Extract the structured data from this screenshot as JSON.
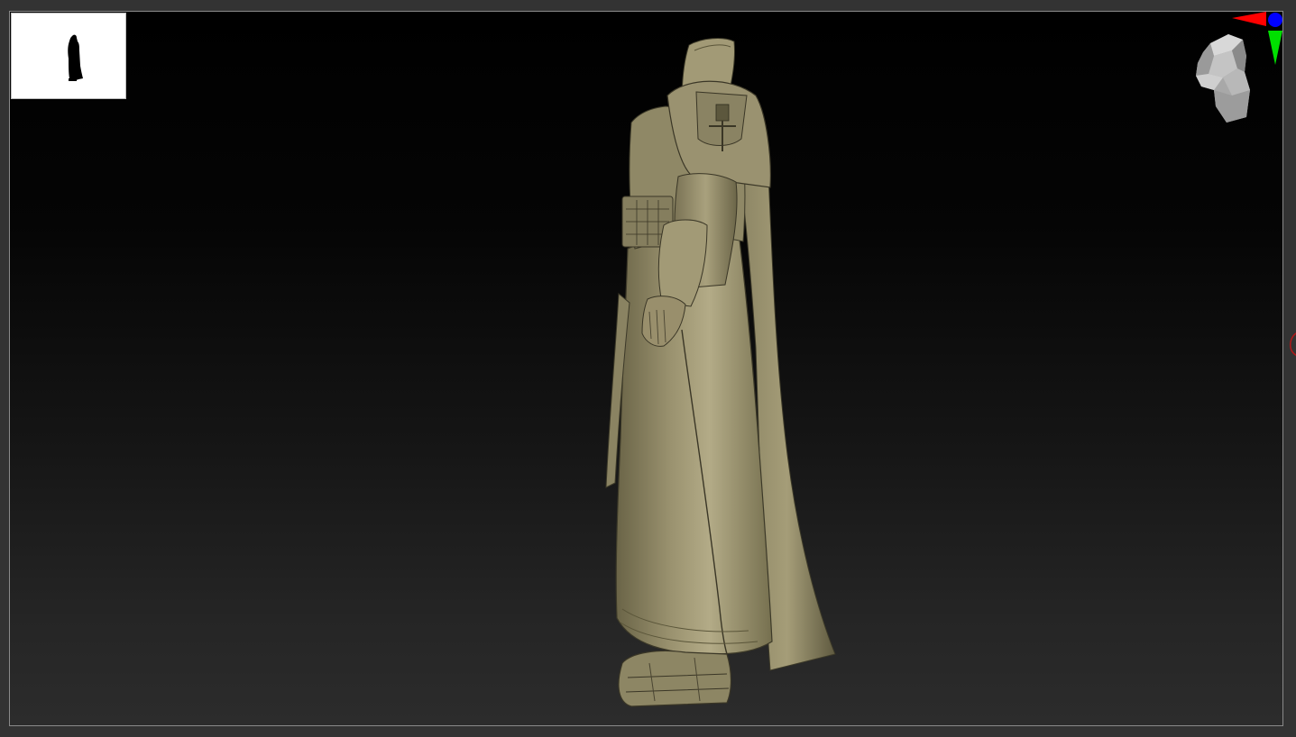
{
  "app": {
    "colors": {
      "background": "#333333",
      "viewport_border": "#8a8a8a",
      "model_surface": "#8c8564",
      "model_highlight": "#b3ab87",
      "model_shadow": "#4e4a37",
      "axis_x": "#ff0000",
      "axis_y": "#00e000",
      "axis_z": "#0000ff",
      "navigator_bg": "#ffffff",
      "navigator_silhouette": "#000000",
      "edge_marker": "#b01818"
    }
  },
  "viewport": {
    "navigator": {
      "icon": "silhouette-thumbnail"
    },
    "gizmo": {
      "icon": "orientation-head-icon",
      "axes": [
        "x-axis-red",
        "y-axis-green",
        "z-axis-blue"
      ]
    },
    "model": {
      "icon": "robed-figure-sculpt"
    }
  }
}
